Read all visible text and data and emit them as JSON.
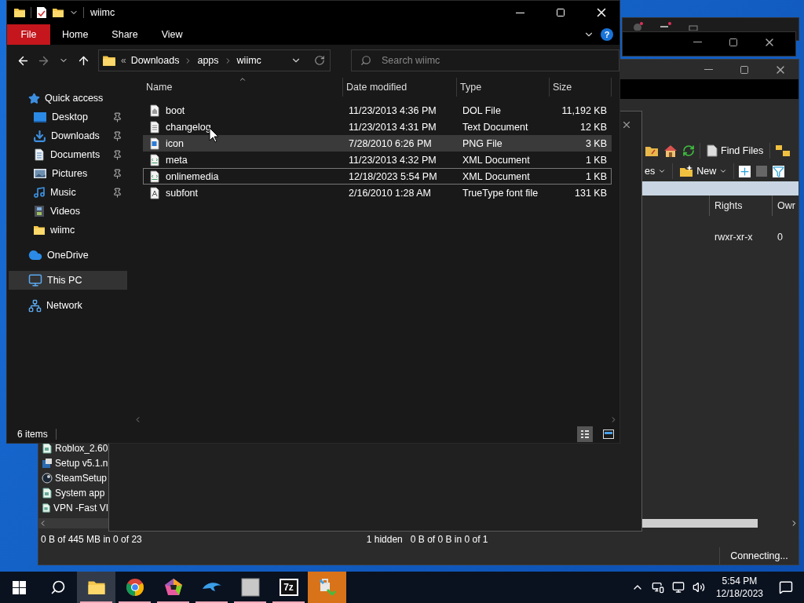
{
  "explorer": {
    "title": "wiimc",
    "ribbon": [
      {
        "label": "File",
        "kind": "file"
      },
      {
        "label": "Home",
        "kind": "tab"
      },
      {
        "label": "Share",
        "kind": "tab"
      },
      {
        "label": "View",
        "kind": "tab"
      }
    ],
    "help": "?",
    "nav": {
      "back_disabled": false,
      "forward_disabled": true
    },
    "address": {
      "overflow": "«",
      "crumbs": [
        "Downloads",
        "apps",
        "wiimc"
      ]
    },
    "search": {
      "placeholder": "Search wiimc"
    },
    "sidebar": [
      {
        "label": "Quick access",
        "kind": "star",
        "selected": false,
        "children": [
          {
            "label": "Desktop",
            "kind": "desktop",
            "pinned": true,
            "selected": false
          },
          {
            "label": "Downloads",
            "kind": "downloads",
            "pinned": true,
            "selected": false
          },
          {
            "label": "Documents",
            "kind": "documents",
            "pinned": true,
            "selected": false
          },
          {
            "label": "Pictures",
            "kind": "pictures",
            "pinned": true,
            "selected": false
          },
          {
            "label": "Music",
            "kind": "music",
            "pinned": true,
            "selected": false
          },
          {
            "label": "Videos",
            "kind": "videos",
            "pinned": false,
            "selected": false
          },
          {
            "label": "wiimc",
            "kind": "folder",
            "pinned": false,
            "selected": false
          }
        ]
      },
      {
        "label": "OneDrive",
        "kind": "cloud",
        "selected": false
      },
      {
        "label": "This PC",
        "kind": "pc",
        "selected": true
      },
      {
        "label": "Network",
        "kind": "network",
        "selected": false
      }
    ],
    "columns": [
      "Name",
      "Date modified",
      "Type",
      "Size"
    ],
    "files": [
      {
        "name": "boot",
        "date": "11/23/2013 4:36 PM",
        "type": "DOL File",
        "size": "11,192 KB",
        "kind": "dol",
        "selected": false,
        "focused": false
      },
      {
        "name": "changelog",
        "date": "11/23/2013 4:31 PM",
        "type": "Text Document",
        "size": "12 KB",
        "kind": "text",
        "selected": false,
        "focused": false
      },
      {
        "name": "icon",
        "date": "7/28/2010 6:26 PM",
        "type": "PNG File",
        "size": "3 KB",
        "kind": "png",
        "selected": true,
        "focused": false
      },
      {
        "name": "meta",
        "date": "11/23/2013 4:32 PM",
        "type": "XML Document",
        "size": "1 KB",
        "kind": "xml",
        "selected": false,
        "focused": false
      },
      {
        "name": "onlinemedia",
        "date": "12/18/2023 5:54 PM",
        "type": "XML Document",
        "size": "1 KB",
        "kind": "xml",
        "selected": false,
        "focused": true
      },
      {
        "name": "subfont",
        "date": "2/16/2010 1:28 AM",
        "type": "TrueType font file",
        "size": "131 KB",
        "kind": "font",
        "selected": false,
        "focused": false
      }
    ],
    "status": "6 items"
  },
  "transfer_window": {
    "toolbar": {
      "find_files": "Find Files",
      "partial_label": "es",
      "new": "New"
    },
    "local_files": [
      {
        "name": "Roblox_2.60",
        "kind": "package"
      },
      {
        "name": "Setup v5.1.n",
        "kind": "setup"
      },
      {
        "name": "SteamSetup",
        "kind": "steam"
      },
      {
        "name": "System app",
        "kind": "package"
      },
      {
        "name": "VPN -Fast VI",
        "kind": "package"
      }
    ],
    "remote_columns": [
      "Rights",
      "Owr"
    ],
    "remote_rows": [
      {
        "rights": "rwxr-xr-x",
        "owner": "0"
      }
    ],
    "status_left": "0 B of 445 MB in 0 of 23",
    "status_hidden": "1 hidden",
    "status_right": "0 B of 0 B in 0 of 1",
    "connection": "Connecting..."
  },
  "taskbar": {
    "apps": [
      {
        "kind": "explorer",
        "running": true,
        "active": true
      },
      {
        "kind": "chrome",
        "running": true,
        "active": false
      },
      {
        "kind": "pentagon",
        "running": true,
        "active": false
      },
      {
        "kind": "dolphin",
        "running": true,
        "active": false
      },
      {
        "kind": "elf",
        "running": true,
        "active": false
      },
      {
        "kind": "sevenzip",
        "label": "7z",
        "running": true,
        "active": false
      },
      {
        "kind": "transfer",
        "running": false,
        "active": false,
        "flashing": true
      }
    ],
    "time": "5:54 PM",
    "date": "12/18/2023"
  }
}
